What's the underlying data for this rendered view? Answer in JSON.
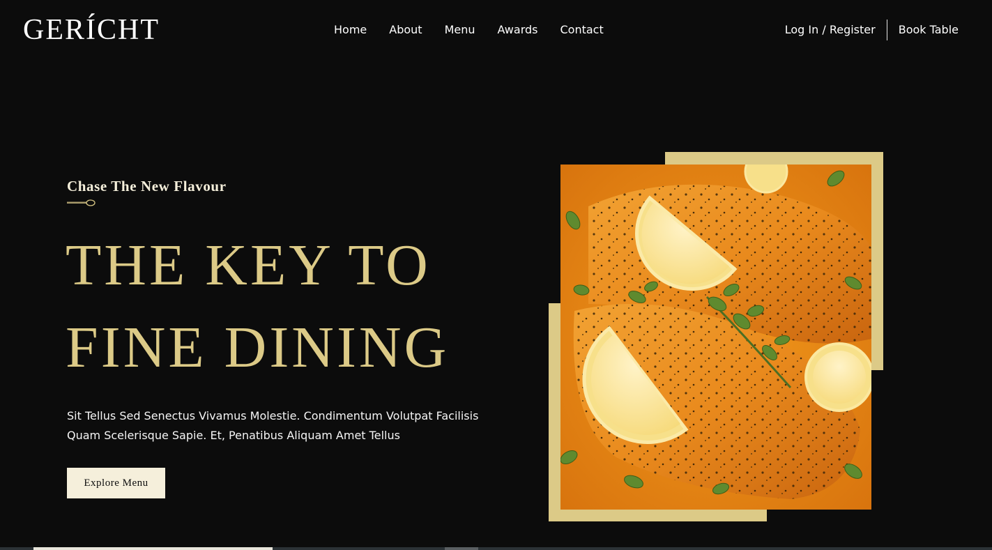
{
  "brand": {
    "logo": "GERÍCHT"
  },
  "nav": {
    "links": [
      {
        "label": "Home"
      },
      {
        "label": "About"
      },
      {
        "label": "Menu"
      },
      {
        "label": "Awards"
      },
      {
        "label": "Contact"
      }
    ],
    "login_label": "Log In / Register",
    "book_label": "Book Table"
  },
  "hero": {
    "subtitle": "Chase The New Flavour",
    "headline_line1": "THE KEY TO",
    "headline_line2": "FINE DINING",
    "description_line1": "Sit Tellus Sed Senectus Vivamus Molestie. Condimentum Volutpat Facilisis",
    "description_line2": "Quam Scelerisque Sapie. Et, Penatibus Aliquam Amet Tellus",
    "cta_label": "Explore Menu"
  },
  "colors": {
    "background": "#0c0c0c",
    "gold": "#dcca87",
    "cream": "#f5efdb",
    "white": "#ffffff"
  },
  "icons": {
    "spoon": "spoon-icon",
    "food_image": "salmon-dish-image"
  }
}
